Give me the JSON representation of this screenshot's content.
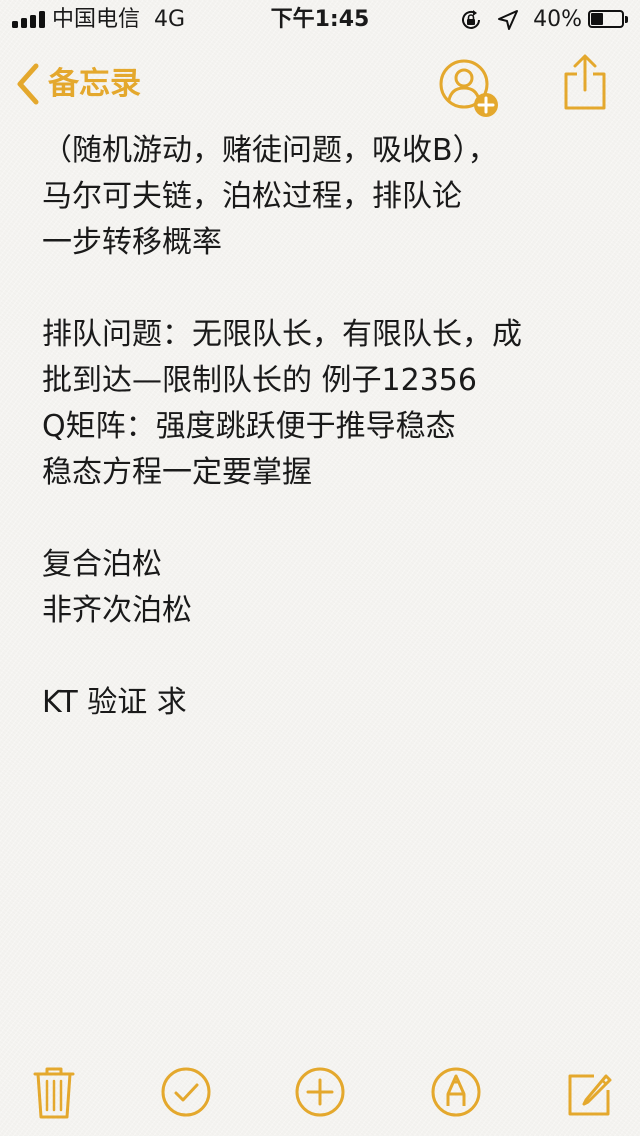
{
  "status_bar": {
    "carrier": "中国电信",
    "network": "4G",
    "time": "下午1:45",
    "battery_percent_label": "40%",
    "battery_level": 0.4,
    "icons": [
      "signal-bars-icon",
      "orientation-lock-icon",
      "location-arrow-icon",
      "battery-icon"
    ]
  },
  "nav": {
    "back_label": "备忘录",
    "icons": {
      "back": "chevron-left-icon",
      "people": "add-people-icon",
      "share": "share-icon"
    }
  },
  "note": {
    "lines": [
      "（随机游动，赌徒问题，吸收B），",
      "马尔可夫链，泊松过程，排队论",
      "一步转移概率",
      "",
      "排队问题：无限队长，有限队长，成",
      "批到达—限制队长的 例子12356",
      "Q矩阵：强度跳跃便于推导稳态",
      "稳态方程一定要掌握",
      "",
      "复合泊松",
      "非齐次泊松",
      "",
      "KT 验证 求"
    ]
  },
  "toolbar": {
    "icons": [
      "trash-icon",
      "checklist-icon",
      "add-icon",
      "markup-icon",
      "compose-icon"
    ]
  },
  "colors": {
    "accent": "#e4a82d",
    "text": "#1a1a1a",
    "background": "#f4f3f0"
  }
}
